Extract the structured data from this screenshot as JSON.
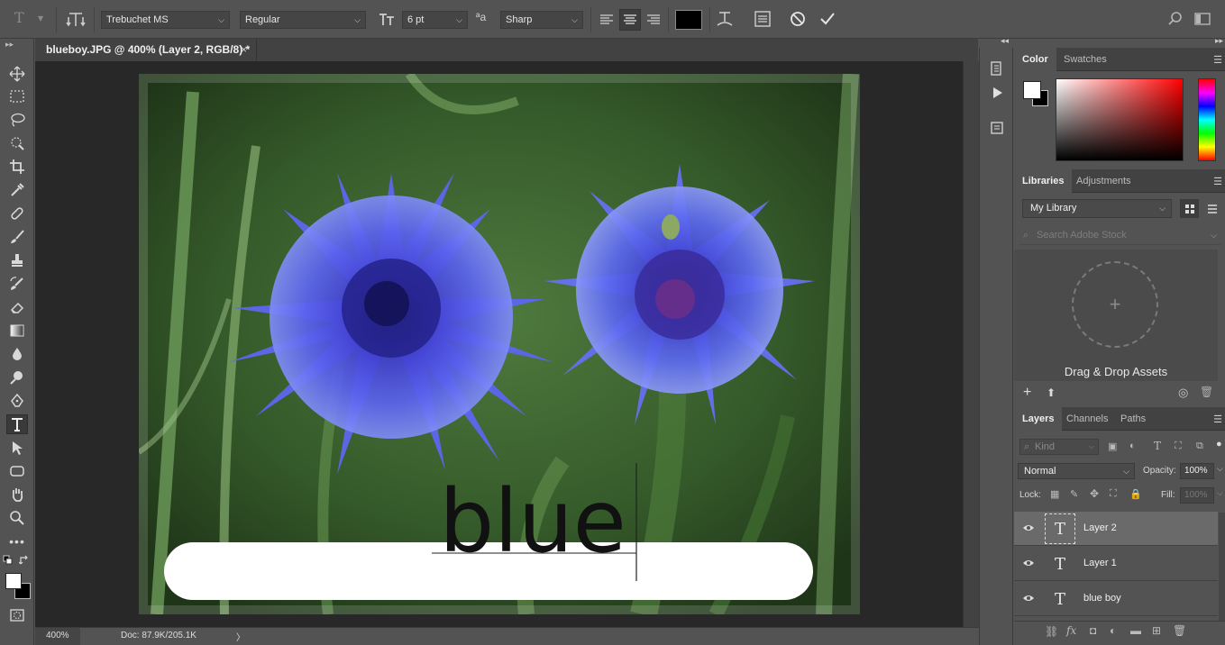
{
  "options_bar": {
    "font_family": "Trebuchet MS",
    "font_style": "Regular",
    "font_size": "6 pt",
    "antialias": "Sharp",
    "text_color": "#000000",
    "alignment": "center"
  },
  "toolbar": {
    "active_tool": "type",
    "foreground_color": "#ffffff",
    "background_color": "#000000"
  },
  "document": {
    "tab_title": "blueboy.JPG @ 400% (Layer 2, RGB/8) *",
    "close_glyph": "×",
    "canvas_text": "blue",
    "zoom": "400%",
    "doc_size": "Doc: 87.9K/205.1K",
    "status_arrow": "〉"
  },
  "color_panel": {
    "tabs": [
      "Color",
      "Swatches"
    ],
    "active_tab": "Color"
  },
  "libraries_panel": {
    "tabs": [
      "Libraries",
      "Adjustments"
    ],
    "library": "My Library",
    "search_placeholder": "Search Adobe Stock",
    "drop_label": "Drag & Drop Assets",
    "plus_glyph": "+"
  },
  "layers_panel": {
    "tabs": [
      "Layers",
      "Channels",
      "Paths"
    ],
    "filter": "Kind",
    "blend_mode": "Normal",
    "opacity_label": "Opacity:",
    "opacity": "100%",
    "lock_label": "Lock:",
    "fill_label": "Fill:",
    "fill": "100%",
    "layers": [
      {
        "name": "Layer 2",
        "type": "text",
        "selected": true
      },
      {
        "name": "Layer 1",
        "type": "text",
        "selected": false
      },
      {
        "name": "blue boy",
        "type": "text",
        "selected": false
      }
    ],
    "thumb_glyph": "T"
  }
}
